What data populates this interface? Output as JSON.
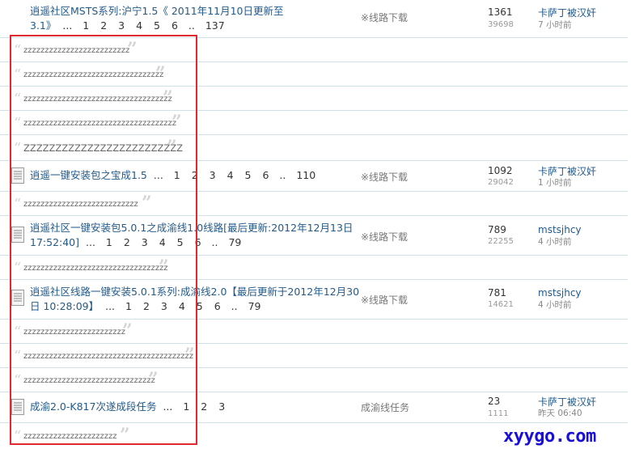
{
  "threads": [
    {
      "title_line1": "逍遥社区MSTS系列:沪宁1.5《 2011年11月10日更新至",
      "title_line2": "3.1》",
      "pages": [
        "1",
        "2",
        "3",
        "4",
        "5",
        "6"
      ],
      "dots": "..",
      "last_page": "137",
      "page_ellipsis": "...",
      "category": "※线路下载",
      "replies": "1361",
      "views": "39698",
      "author": "卡萨丁被汉奸",
      "time": "7 小时前"
    },
    {
      "title_line1": "逍遥一键安装包之宝成1.5",
      "pages": [
        "1",
        "2",
        "3",
        "4",
        "5",
        "6"
      ],
      "dots": "..",
      "last_page": "110",
      "page_ellipsis": "...",
      "category": "※线路下载",
      "replies": "1092",
      "views": "29042",
      "author": "卡萨丁被汉奸",
      "time": "1 小时前"
    },
    {
      "title_line1": "逍遥社区一键安装包5.0.1之成渝线1.0线路[最后更新:2012年12月13日",
      "title_line2": "17:52:40]",
      "pages": [
        "1",
        "2",
        "3",
        "4",
        "5",
        "6"
      ],
      "dots": "..",
      "last_page": "79",
      "page_ellipsis": "...",
      "category": "※线路下载",
      "replies": "789",
      "views": "22255",
      "author": "mstsjhcy",
      "time": "4 小时前"
    },
    {
      "title_line1": "逍遥社区线路一键安装5.0.1系列:成渝线2.0【最后更新于2012年12月30",
      "title_line2": "日 10:28:09】",
      "pages": [
        "1",
        "2",
        "3",
        "4",
        "5",
        "6"
      ],
      "dots": "..",
      "last_page": "79",
      "page_ellipsis": "...",
      "category": "※线路下载",
      "replies": "781",
      "views": "14621",
      "author": "mstsjhcy",
      "time": "4 小时前"
    },
    {
      "title_line1": "成渝2.0-K817次遂成段任务",
      "pages": [
        "1",
        "2",
        "3"
      ],
      "page_ellipsis": "...",
      "category": "成渝线任务",
      "replies": "23",
      "views": "1111",
      "author": "卡萨丁被汉奸",
      "time": "昨天 06:40"
    }
  ],
  "quotes": {
    "q1": "zzzzzzzzzzzzzzzzzzzzzzzzz",
    "q2": "zzzzzzzzzzzzzzzzzzzzzzzzzzzzzzzzz",
    "q3": "zzzzzzzzzzzzzzzzzzzzzzzzzzzzzzzzzzz",
    "q4": "zzzzzzzzzzzzzzzzzzzzzzzzzzzzzzzzzzzz",
    "q5": "ZZZZZZZZZZZZZZZZZZZZZZZZZ",
    "q6": "zzzzzzzzzzzzzzzzzzzzzzzzzzz",
    "q7": "zzzzzzzzzzzzzzzzzzzzzzzzzzzzzzzzzz",
    "q8": "zzzzzzzzzzzzzzzzzzzzzzzz",
    "q9": "zzzzzzzzzzzzzzzzzzzzzzzzzzzzzzzzzzzzzzzz",
    "q10": "zzzzzzzzzzzzzzzzzzzzzzzzzzzzzzz",
    "q11": "zzzzzzzzzzzzzzzzzzzzzz"
  },
  "watermark": "xyygo.com",
  "colors": {
    "link": "#225a8c",
    "highlight": "#e0282e",
    "watermark": "#1a0fd6"
  }
}
